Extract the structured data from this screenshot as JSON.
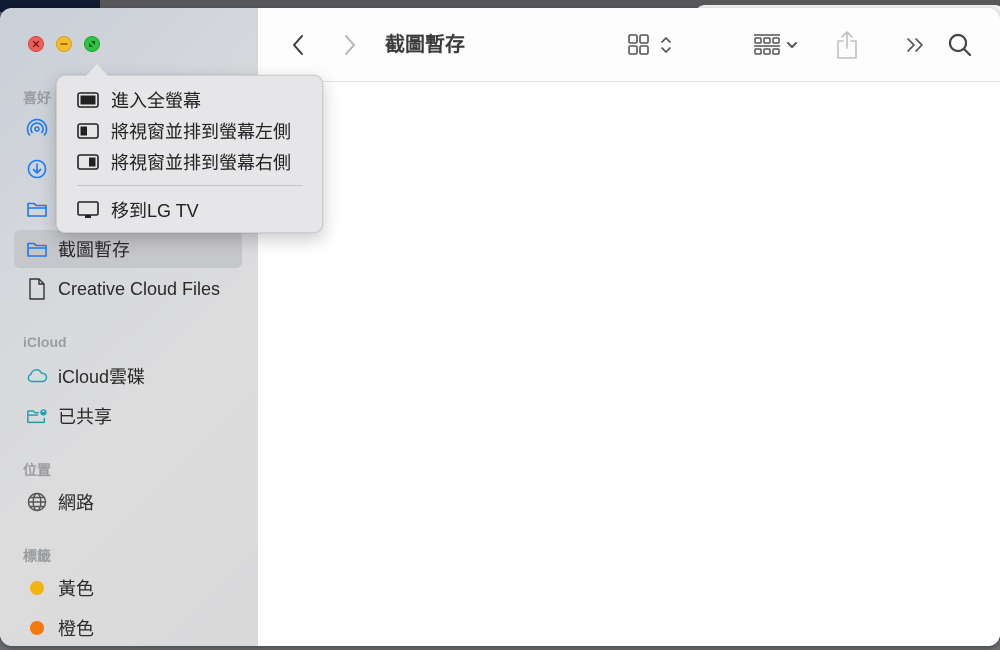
{
  "window": {
    "title": "截圖暫存",
    "traffic_lights": {
      "close": {
        "icon": "close-icon",
        "color": "#ec5f58"
      },
      "minimize": {
        "icon": "minimize-icon",
        "color": "#f4bb2f"
      },
      "fullscreen": {
        "icon": "fullscreen-icon",
        "color": "#2cc440"
      }
    }
  },
  "toolbar": {
    "back_icon": "chevron-left-icon",
    "forward_icon": "chevron-right-icon",
    "view_icon": "grid-view-icon",
    "group_icon": "group-by-icon",
    "share_icon": "share-icon",
    "more_icon": "double-chevron-right-icon",
    "search_icon": "search-icon"
  },
  "fullscreen_menu": {
    "items": [
      {
        "label": "進入全螢幕",
        "icon": "fullscreen-window-icon"
      },
      {
        "label": "將視窗並排到螢幕左側",
        "icon": "tile-left-icon"
      },
      {
        "label": "將視窗並排到螢幕右側",
        "icon": "tile-right-icon"
      }
    ],
    "move_item": {
      "label": "移到LG TV",
      "icon": "display-icon"
    }
  },
  "sidebar": {
    "favorites_heading": "喜好",
    "favorites": [
      {
        "label": "",
        "icon": "airdrop-icon"
      },
      {
        "label": "",
        "icon": "downloads-icon"
      },
      {
        "label": "",
        "icon": "folder-icon"
      },
      {
        "label": "截圖暫存",
        "icon": "folder-icon",
        "selected": true
      },
      {
        "label": "Creative Cloud Files",
        "icon": "document-icon"
      }
    ],
    "icloud_heading": "iCloud",
    "icloud": [
      {
        "label": "iCloud雲碟",
        "icon": "cloud-icon"
      },
      {
        "label": "已共享",
        "icon": "shared-folder-icon"
      }
    ],
    "locations_heading": "位置",
    "locations": [
      {
        "label": "網路",
        "icon": "globe-icon"
      }
    ],
    "tags_heading": "標籤",
    "tags": [
      {
        "label": "黃色",
        "color": "#f2b50f"
      },
      {
        "label": "橙色",
        "color": "#f5790e"
      }
    ]
  }
}
